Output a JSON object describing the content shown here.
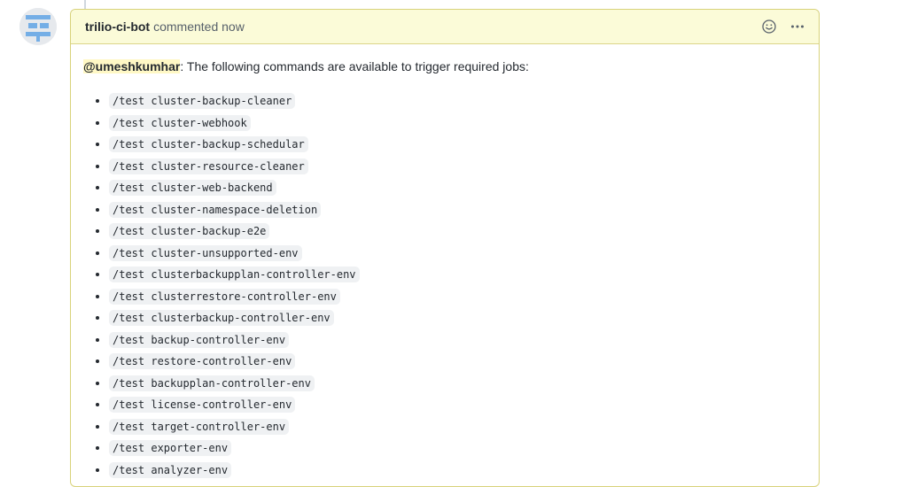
{
  "comment": {
    "author": "trilio-ci-bot",
    "meta": "commented now",
    "mention": "@umeshkumhar",
    "intro_text": ": The following commands are available to trigger required jobs:",
    "commands": [
      "/test cluster-backup-cleaner",
      "/test cluster-webhook",
      "/test cluster-backup-schedular",
      "/test cluster-resource-cleaner",
      "/test cluster-web-backend",
      "/test cluster-namespace-deletion",
      "/test cluster-backup-e2e",
      "/test cluster-unsupported-env",
      "/test clusterbackupplan-controller-env",
      "/test clusterrestore-controller-env",
      "/test clusterbackup-controller-env",
      "/test backup-controller-env",
      "/test restore-controller-env",
      "/test backupplan-controller-env",
      "/test license-controller-env",
      "/test target-controller-env",
      "/test exporter-env",
      "/test analyzer-env"
    ]
  },
  "icons": {
    "avatar": "bot-avatar",
    "reaction": "smiley-icon",
    "menu": "kebab-horizontal-icon"
  },
  "colors": {
    "header_bg": "#fbfbd8",
    "header_border": "#d8d27a",
    "mention_bg": "#fff8c5",
    "avatar_blue": "#6aa7e0"
  }
}
